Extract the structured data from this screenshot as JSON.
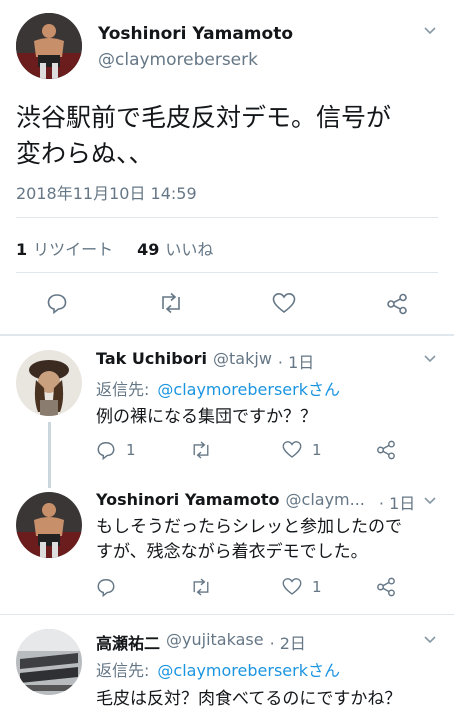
{
  "main_tweet": {
    "name": "Yoshinori Yamamoto",
    "handle": "@claymoreberserk",
    "text_line1": "渋谷駅前で毛皮反対デモ。信号が",
    "text_line2": "変わらぬ、、",
    "timestamp": "2018年11月10日 14:59",
    "retweet_count": "1",
    "retweet_label": "リツイート",
    "like_count": "49",
    "like_label": "いいね"
  },
  "replies": [
    {
      "name": "Tak Uchibori",
      "handle": "@takjw",
      "time": "· 1日",
      "reply_prefix": "返信先:",
      "reply_to": "@claymoreberserkさん",
      "text": "例の裸になる集団ですか？？",
      "reply_count": "1",
      "like_count": "1"
    },
    {
      "name": "Yoshinori Yamamoto",
      "handle": "@claym...",
      "time": "· 1日",
      "text_line1": "もしそうだったらシレッと参加したので",
      "text_line2": "すが、残念ながら着衣デモでした。",
      "like_count": "1"
    },
    {
      "name": "高瀬祐二",
      "handle": "@yujitakase",
      "time": "· 2日",
      "reply_prefix": "返信先:",
      "reply_to": "@claymoreberserkさん",
      "text": "毛皮は反対？肉食べてるのにですかね？"
    }
  ],
  "icons": [
    "chevron-down-icon",
    "reply-icon",
    "retweet-icon",
    "like-icon",
    "share-icon"
  ],
  "colors": {
    "link": "#1b95e0",
    "muted": "#657786",
    "text": "#14171a",
    "divider": "#e1e8ed"
  }
}
